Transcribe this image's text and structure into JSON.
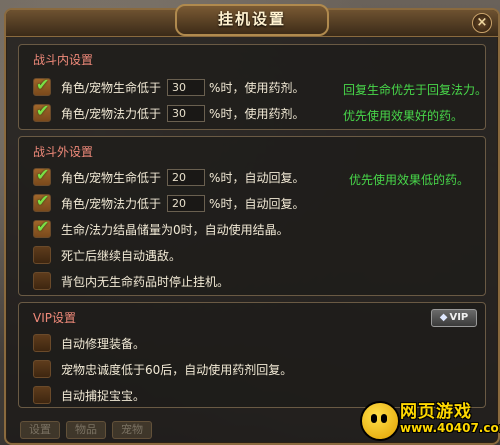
{
  "window": {
    "title": "挂机设置",
    "close_label": "×"
  },
  "in_battle": {
    "title": "战斗内设置",
    "rows": [
      {
        "checked": true,
        "prefix": "角色/宠物生命低于",
        "value": "30",
        "suffix": "%时，使用药剂。",
        "hint": "回复生命优先于回复法力。"
      },
      {
        "checked": true,
        "prefix": "角色/宠物法力低于",
        "value": "30",
        "suffix": "%时，使用药剂。",
        "hint": "优先使用效果好的药。"
      }
    ]
  },
  "out_battle": {
    "title": "战斗外设置",
    "rows": [
      {
        "checked": true,
        "prefix": "角色/宠物生命低于",
        "value": "20",
        "suffix": "%时，自动回复。",
        "hint": "优先使用效果低的药。"
      },
      {
        "checked": true,
        "prefix": "角色/宠物法力低于",
        "value": "20",
        "suffix": "%时，自动回复。"
      },
      {
        "checked": true,
        "label": "生命/法力结晶储量为0时，自动使用结晶。"
      },
      {
        "checked": false,
        "label": "死亡后继续自动遇敌。"
      },
      {
        "checked": false,
        "label": "背包内无生命药品时停止挂机。"
      }
    ]
  },
  "vip": {
    "title": "VIP设置",
    "badge": "VIP",
    "rows": [
      {
        "checked": false,
        "label": "自动修理装备。"
      },
      {
        "checked": false,
        "label": "宠物忠诚度低于60后，自动使用药剂回复。"
      },
      {
        "checked": false,
        "label": "自动捕捉宝宝。"
      }
    ]
  },
  "watermark": {
    "brand": "网页游戏",
    "url": "www.40407.com"
  },
  "bottom_tabs": [
    "设置",
    "物品",
    "宠物"
  ],
  "colors": {
    "section_title": "#f08a7a",
    "hint": "#48d84a",
    "frame": "#8a6a3e"
  }
}
